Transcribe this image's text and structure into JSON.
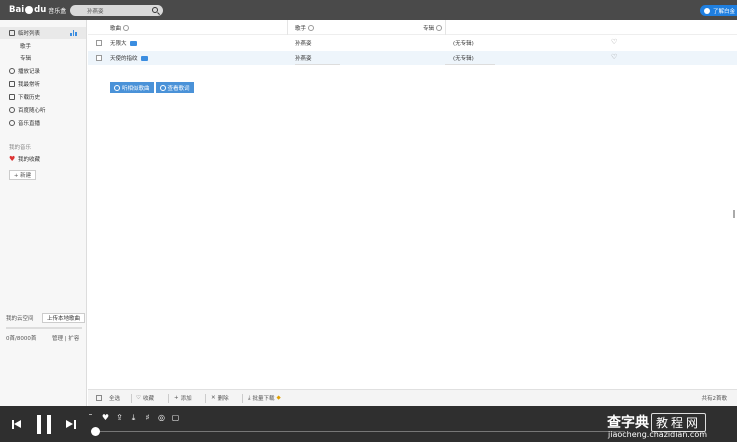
{
  "header": {
    "logo_text": "Bai",
    "logo_text2": "du",
    "logo_sub": "音乐盒",
    "search_value": "孙燕姿",
    "promo_label": "了解白金"
  },
  "sidebar": {
    "items": [
      {
        "label": "临时列表",
        "icon": "list-icon"
      },
      {
        "label": "歌手",
        "icon": ""
      },
      {
        "label": "专辑",
        "icon": ""
      },
      {
        "label": "播放记录",
        "icon": "clock-icon"
      },
      {
        "label": "我最常听",
        "icon": "chart-icon"
      },
      {
        "label": "下载历史",
        "icon": "download-icon"
      },
      {
        "label": "百度随心听",
        "icon": "radio-icon"
      },
      {
        "label": "音乐直播",
        "icon": "live-icon"
      }
    ],
    "section_title": "我的音乐",
    "favorites_label": "我的收藏",
    "new_button": "+ 新建",
    "cloud_label": "我的云空间",
    "upload_button": "上传本地歌曲",
    "quota_text": "0首/8000首",
    "manage_label": "管理",
    "expand_label": "扩容"
  },
  "table": {
    "headers": {
      "song": "歌曲",
      "artist": "歌手",
      "album": "专辑"
    },
    "rows": [
      {
        "song": "无限大",
        "artist": "孙燕姿",
        "album": "(无专辑)"
      },
      {
        "song": "天使的指纹",
        "artist": "孙燕姿",
        "album": "(无专辑)"
      }
    ]
  },
  "actions": {
    "listen_similar": "听相似歌曲",
    "view_lyrics": "查看歌词"
  },
  "bottom_toolbar": {
    "select_all": "全选",
    "favorite": "收藏",
    "add": "添加",
    "delete": "删除",
    "batch_download": "批量下载",
    "total": "共有2首歌"
  },
  "watermark": {
    "main": "查字典",
    "boxed": "教程网",
    "url": "jiaocheng.chazidian.com"
  },
  "colors": {
    "topbar": "#4a4a4a",
    "accent": "#3b8de0",
    "player": "#2f2f2f",
    "row_alt": "#eef5fb"
  }
}
